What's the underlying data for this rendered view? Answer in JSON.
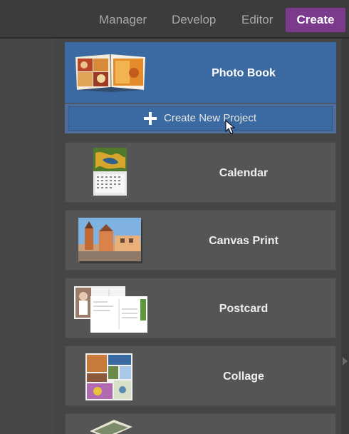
{
  "nav": {
    "manager": "Manager",
    "develop": "Develop",
    "editor": "Editor",
    "create": "Create",
    "active": "Create",
    "active_color": "#7c3a8c"
  },
  "projects": {
    "items": [
      {
        "label": "Photo Book",
        "selected": true,
        "icon": "photo-book-thumbnail"
      },
      {
        "label": "Calendar",
        "selected": false,
        "icon": "calendar-thumbnail"
      },
      {
        "label": "Canvas Print",
        "selected": false,
        "icon": "canvas-print-thumbnail"
      },
      {
        "label": "Postcard",
        "selected": false,
        "icon": "postcard-thumbnail"
      },
      {
        "label": "Collage",
        "selected": false,
        "icon": "collage-thumbnail"
      }
    ],
    "create_new_label": "Create New Project",
    "selected_color": "#3a6aa1"
  }
}
